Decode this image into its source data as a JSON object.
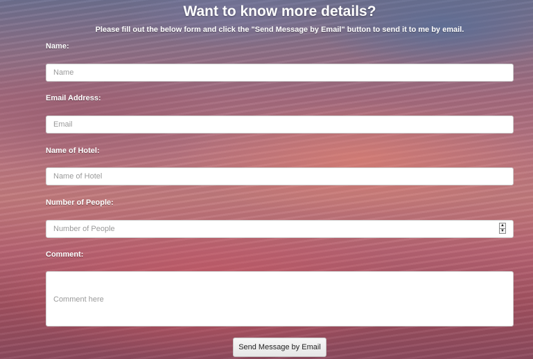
{
  "header": {
    "title": "Want to know more details?",
    "subtitle": "Please fill out the below form and click the \"Send Message by Email\" button to send it to me by email."
  },
  "form": {
    "name": {
      "label": "Name:",
      "placeholder": "Name",
      "value": ""
    },
    "email": {
      "label": "Email Address:",
      "placeholder": "Email",
      "value": ""
    },
    "hotel": {
      "label": "Name of Hotel:",
      "placeholder": "Name of Hotel",
      "value": ""
    },
    "people": {
      "label": "Number of People:",
      "placeholder": "Number of People",
      "value": ""
    },
    "comment": {
      "label": "Comment:",
      "placeholder": "Comment here",
      "value": ""
    },
    "submit_label": "Send Message by Email"
  },
  "icons": {
    "spinner_up": "▲",
    "spinner_down": "▼"
  }
}
